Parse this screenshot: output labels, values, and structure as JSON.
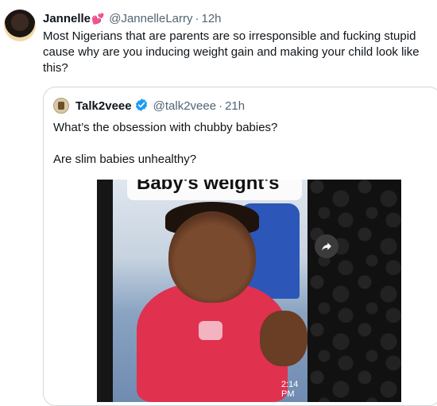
{
  "tweet": {
    "author_name": "Jannelle",
    "author_emoji": "💕",
    "handle": "@JannelleLarry",
    "separator": "·",
    "time": "12h",
    "text": "Most Nigerians that are parents are so irresponsible and fucking stupid cause why are you inducing weight gain and making your child look like this?"
  },
  "quote": {
    "author_name": "Talk2veee",
    "handle": "@talk2veee",
    "separator": "·",
    "time": "21h",
    "text_line1": "What’s the obsession with chubby babies?",
    "text_line2": "Are slim babies unhealthy?",
    "media": {
      "caption": "Baby's weight's",
      "timestamp": "2:14 PM"
    }
  },
  "colors": {
    "text_primary": "#0f1419",
    "text_secondary": "#536471",
    "verified_blue": "#1d9bf0",
    "heart": "#e0245e",
    "border": "#cfd9de"
  },
  "icons": {
    "verified": "verified-badge-icon",
    "share": "share-arrow-icon"
  }
}
